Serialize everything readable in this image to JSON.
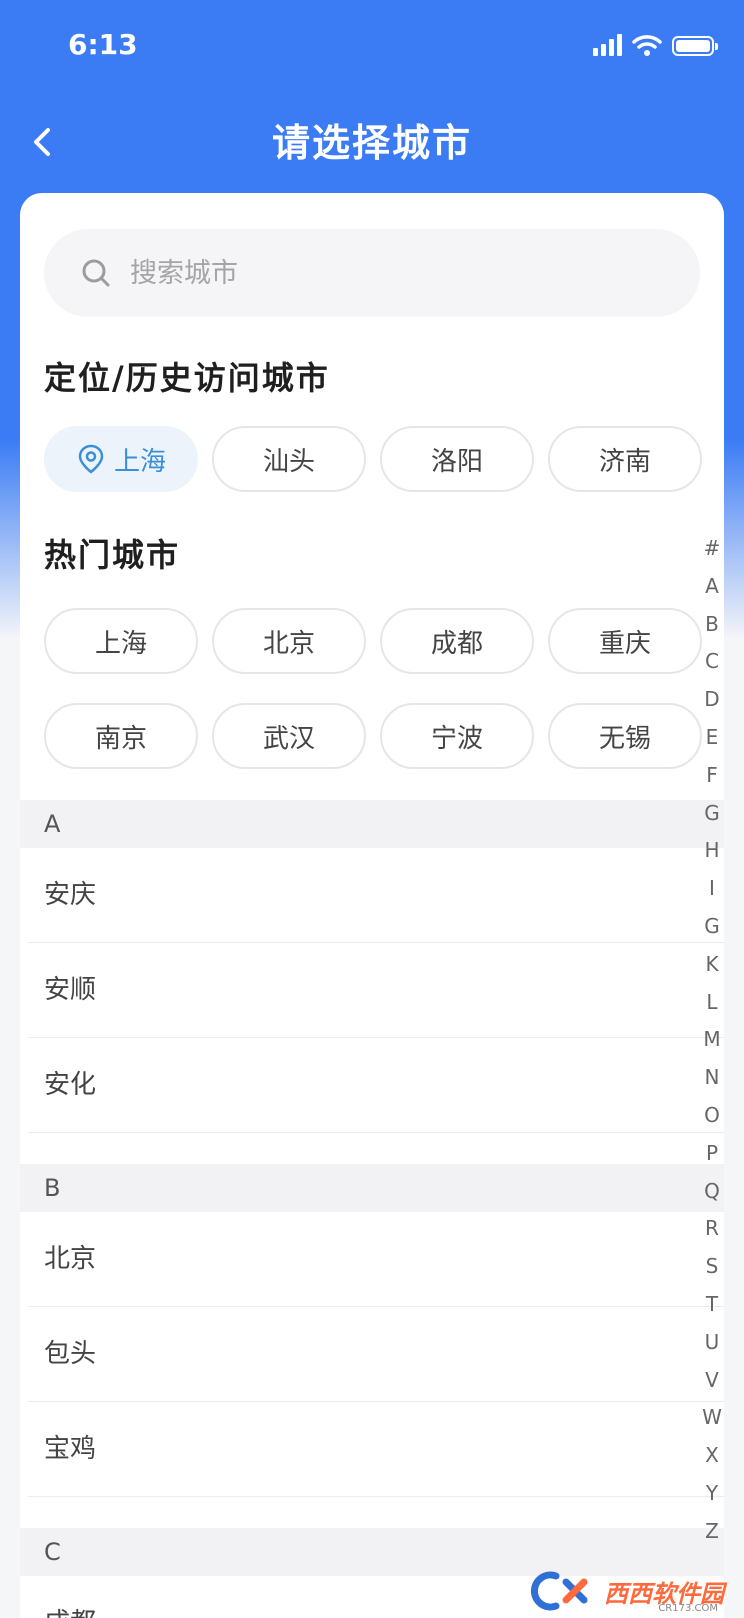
{
  "status_bar": {
    "time": "6:13"
  },
  "nav": {
    "title": "请选择城市"
  },
  "search": {
    "placeholder": "搜索城市"
  },
  "history": {
    "title": "定位/历史访问城市",
    "located_city": "上海",
    "cities": [
      "汕头",
      "洛阳",
      "济南"
    ]
  },
  "hot": {
    "title": "热门城市",
    "rows": [
      [
        "上海",
        "北京",
        "成都",
        "重庆"
      ],
      [
        "南京",
        "武汉",
        "宁波",
        "无锡"
      ]
    ]
  },
  "groups": [
    {
      "letter": "A",
      "cities": [
        "安庆",
        "安顺",
        "安化"
      ]
    },
    {
      "letter": "B",
      "cities": [
        "北京",
        "包头",
        "宝鸡"
      ]
    },
    {
      "letter": "C",
      "cities": [
        "成都"
      ]
    }
  ],
  "index_letters": [
    "#",
    "A",
    "B",
    "C",
    "D",
    "E",
    "F",
    "G",
    "H",
    "I",
    "G",
    "K",
    "L",
    "M",
    "N",
    "O",
    "P",
    "Q",
    "R",
    "S",
    "T",
    "U",
    "V",
    "W",
    "X",
    "Y",
    "Z"
  ],
  "watermark": {
    "brand": "西西软件园",
    "sub": "CR173.COM"
  },
  "colors": {
    "primary": "#3b7cf5",
    "located_chip_text": "#3a8fd8",
    "located_chip_bg": "#edf3fb"
  }
}
